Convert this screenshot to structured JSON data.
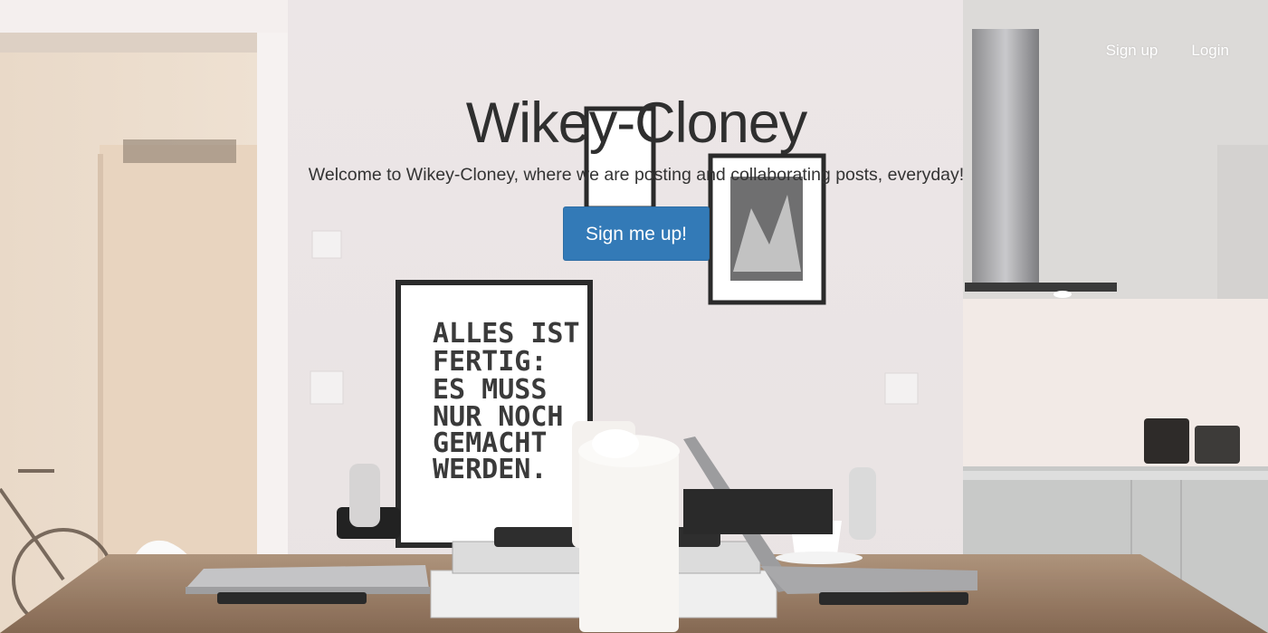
{
  "nav": {
    "signup_label": "Sign up",
    "login_label": "Login"
  },
  "hero": {
    "title": "Wikey-Cloney",
    "subtitle": "Welcome to Wikey-Cloney, where we are posting and collaborating posts, everyday!",
    "cta_label": "Sign me up!"
  },
  "poster": {
    "lines": [
      "ALLES IST",
      "FERTIG:",
      "ES MUSS",
      "NUR NOCH",
      "GEMACHT",
      "WERDEN."
    ]
  },
  "colors": {
    "primary_button": "#337ab7",
    "title_text": "#2f2f2f",
    "nav_text": "#ffffff"
  }
}
